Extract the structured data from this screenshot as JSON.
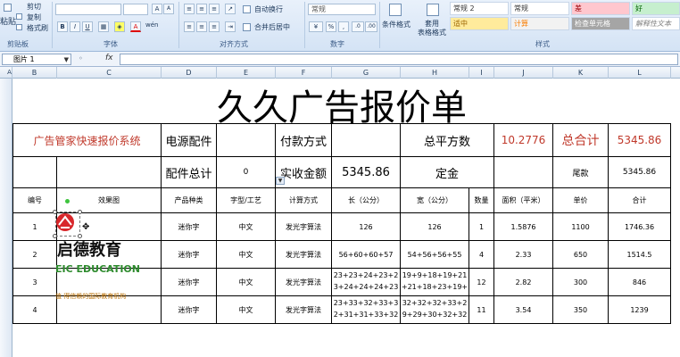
{
  "ribbon": {
    "clipboard": {
      "cut": "剪切",
      "copy": "复制",
      "format_painter": "格式刷",
      "paste": "粘贴",
      "group": "剪贴板"
    },
    "font": {
      "group": "字体",
      "bold": "B",
      "italic": "I",
      "underline": "U",
      "grow": "A",
      "shrink": "A",
      "color_letter": "A",
      "wen": "wén"
    },
    "alignment": {
      "group": "对齐方式",
      "wrap": "自动换行",
      "merge": "合并后居中"
    },
    "number": {
      "group": "数字",
      "format_value": "常规"
    },
    "styles": {
      "group": "样式",
      "conditional": "条件格式",
      "table_format": "套用\n表格格式",
      "cells": [
        {
          "label": "常规 2",
          "bg": "#ffffff",
          "color": "#333333"
        },
        {
          "label": "常规",
          "bg": "#ffffff",
          "color": "#333333"
        },
        {
          "label": "差",
          "bg": "#ffc7ce",
          "color": "#9c0006"
        },
        {
          "label": "好",
          "bg": "#c6efce",
          "color": "#006100"
        },
        {
          "label": "适中",
          "bg": "#ffeb9c",
          "color": "#9c6500"
        },
        {
          "label": "计算",
          "bg": "#f2f2f2",
          "color": "#fa7d00"
        },
        {
          "label": "检查单元格",
          "bg": "#a5a5a5",
          "color": "#ffffff"
        },
        {
          "label": "解释性文本",
          "bg": "#ffffff",
          "color": "#7f7f7f"
        }
      ]
    }
  },
  "formula_bar": {
    "name_box": "图片 1",
    "fx": "fx",
    "value": ""
  },
  "columns": [
    "A",
    "B",
    "C",
    "D",
    "E",
    "F",
    "G",
    "H",
    "I",
    "J",
    "K",
    "L"
  ],
  "title": "久久广告报价单",
  "info_row1": {
    "label": "广告管家快速报价系统",
    "power_parts": "电源配件",
    "payment": "付款方式",
    "total_area": "总平方数",
    "total_area_value": "10.2776",
    "grand_total": "总合计",
    "grand_total_value": "5345.86"
  },
  "info_row2": {
    "parts_total": "配件总计",
    "parts_total_value": "0",
    "received": "实收金额",
    "received_value": "5345.86",
    "deposit": "定金",
    "balance": "尾款",
    "balance_value": "5345.86"
  },
  "table": {
    "headers": [
      "编号",
      "效果图",
      "产品种类",
      "字型/工艺",
      "计算方式",
      "长（公分）",
      "宽（公分）",
      "数量",
      "面积（平米）",
      "单价",
      "合计"
    ],
    "rows": [
      {
        "no": "1",
        "product": "迷你字",
        "font": "中文",
        "method": "发光字算法",
        "length": "126",
        "width": "126",
        "qty": "1",
        "area": "1.5876",
        "price": "1100",
        "total": "1746.36"
      },
      {
        "no": "2",
        "product": "迷你字",
        "font": "中文",
        "method": "发光字算法",
        "length": "56+60+60+57",
        "width": "54+56+56+55",
        "qty": "4",
        "area": "2.33",
        "price": "650",
        "total": "1514.5"
      },
      {
        "no": "3",
        "product": "迷你字",
        "font": "中文",
        "method": "发光字算法",
        "length": "23+23+24+23+23+24+24+24+23+23+23+",
        "width": "19+9+18+19+21+21+18+23+19+22+2",
        "qty": "12",
        "area": "2.82",
        "price": "300",
        "total": "846"
      },
      {
        "no": "4",
        "product": "迷你字",
        "font": "中文",
        "method": "发光字算法",
        "length": "23+33+32+33+32+31+31+33+32+33+",
        "width": "32+32+32+33+29+29+30+32+32+32+",
        "qty": "11",
        "area": "3.54",
        "price": "350",
        "total": "1239"
      }
    ]
  },
  "logo": {
    "name_cn": "启德教育",
    "name_en": "EIC EDUCATION",
    "tagline": "值 得信赖的国际教育机构",
    "brand_color": "#d8272b",
    "accent_color": "#2e8b2e"
  }
}
